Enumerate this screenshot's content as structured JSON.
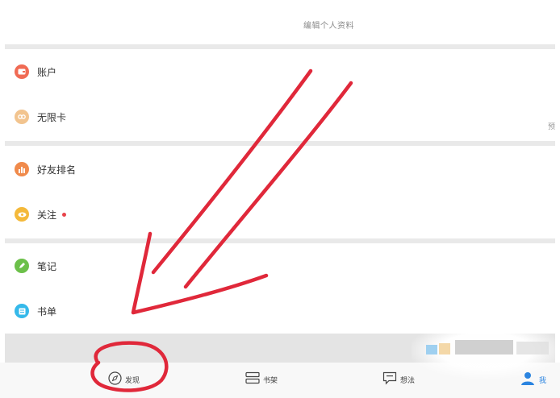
{
  "header": {
    "title": "编辑个人资料"
  },
  "sections": [
    {
      "items": [
        {
          "label": "账户",
          "icon": "wallet-icon",
          "color": "#f06b54"
        },
        {
          "label": "无限卡",
          "icon": "card-icon",
          "color": "#f2c48f"
        }
      ]
    },
    {
      "items": [
        {
          "label": "好友排名",
          "icon": "ranking-icon",
          "color": "#f08a4b"
        },
        {
          "label": "关注",
          "icon": "eye-icon",
          "color": "#f4b93a",
          "badge_color": "#e8434a"
        }
      ]
    },
    {
      "items": [
        {
          "label": "笔记",
          "icon": "pen-icon",
          "color": "#6cc04a"
        },
        {
          "label": "书单",
          "icon": "booklist-icon",
          "color": "#35b9ea"
        }
      ]
    }
  ],
  "side_char": "预",
  "tabs": [
    {
      "label": "发现",
      "icon": "compass-icon"
    },
    {
      "label": "书架",
      "icon": "bookshelf-icon"
    },
    {
      "label": "想法",
      "icon": "comment-icon"
    },
    {
      "label": "我",
      "icon": "profile-icon",
      "color": "#2b84e0"
    }
  ],
  "annotation": {
    "color": "#e0283a"
  }
}
